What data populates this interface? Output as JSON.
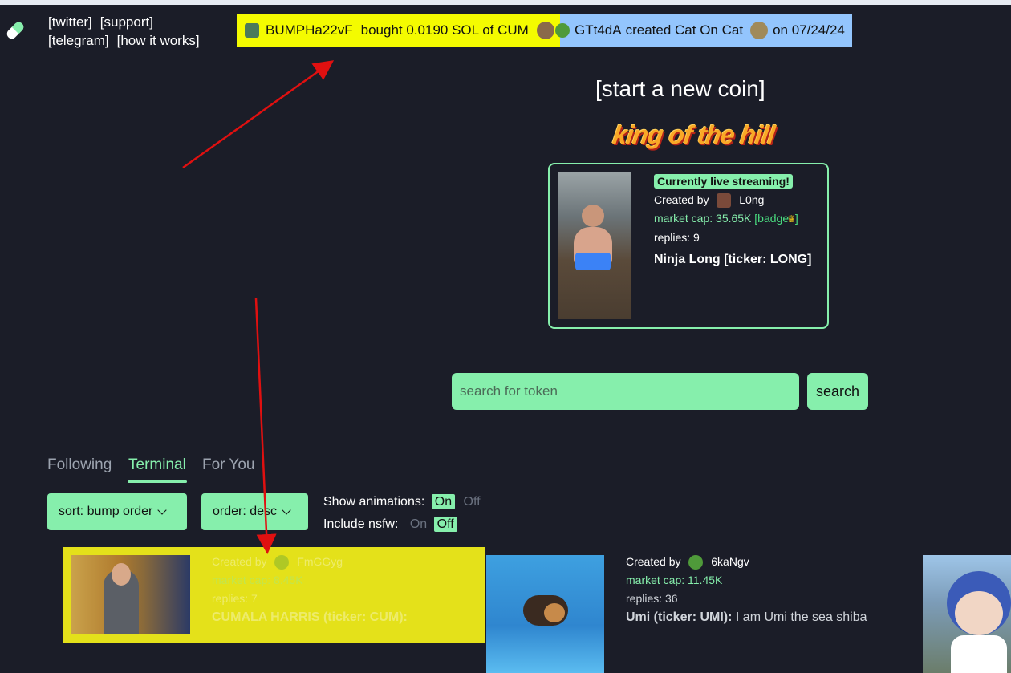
{
  "header": {
    "links": [
      "[twitter]",
      "[support]",
      "[telegram]",
      "[how it works]"
    ]
  },
  "ticker": {
    "trade": {
      "user": "BUMPHa22vF",
      "text": "bought 0.0190 SOL of CUM"
    },
    "created": {
      "user": "GTt4dA",
      "text": "created Cat On Cat",
      "date": "on 07/24/24"
    }
  },
  "start_coin": "[start a new coin]",
  "king_of_the_hill": {
    "banner": "king of the hill",
    "live": "Currently live streaming!",
    "created_by_label": "Created by",
    "creator": "L0ng",
    "market_cap": "market cap: 35.65K",
    "badge": "[badge: ]",
    "replies": "replies: 9",
    "title": "Ninja Long [ticker: LONG]"
  },
  "search": {
    "placeholder": "search for token",
    "button": "search"
  },
  "tabs": [
    "Following",
    "Terminal",
    "For You"
  ],
  "filters": {
    "sort": "sort: bump order",
    "order": "order: desc",
    "show_animations": {
      "label": "Show animations:",
      "on": "On",
      "off": "Off"
    },
    "include_nsfw": {
      "label": "Include nsfw:",
      "on": "On",
      "off": "Off"
    }
  },
  "coins": [
    {
      "created_by_label": "Created by",
      "creator": "FmGGyg",
      "market_cap": "market cap: 8.45K",
      "replies": "replies: 7",
      "title": "CUMALA HARRIS (ticker: CUM):",
      "description": ""
    },
    {
      "created_by_label": "Created by",
      "creator": "6kaNgv",
      "market_cap": "market cap: 11.45K",
      "replies": "replies: 36",
      "title": "Umi (ticker: UMI):",
      "description": "I am Umi the sea shiba"
    }
  ],
  "colors": {
    "accent": "#86efac",
    "ticker_trade": "#f4fb00",
    "ticker_create": "#93c5fd",
    "highlight_card": "#e4e11a",
    "background": "#1b1d28",
    "annotation_arrow": "#e01010"
  }
}
